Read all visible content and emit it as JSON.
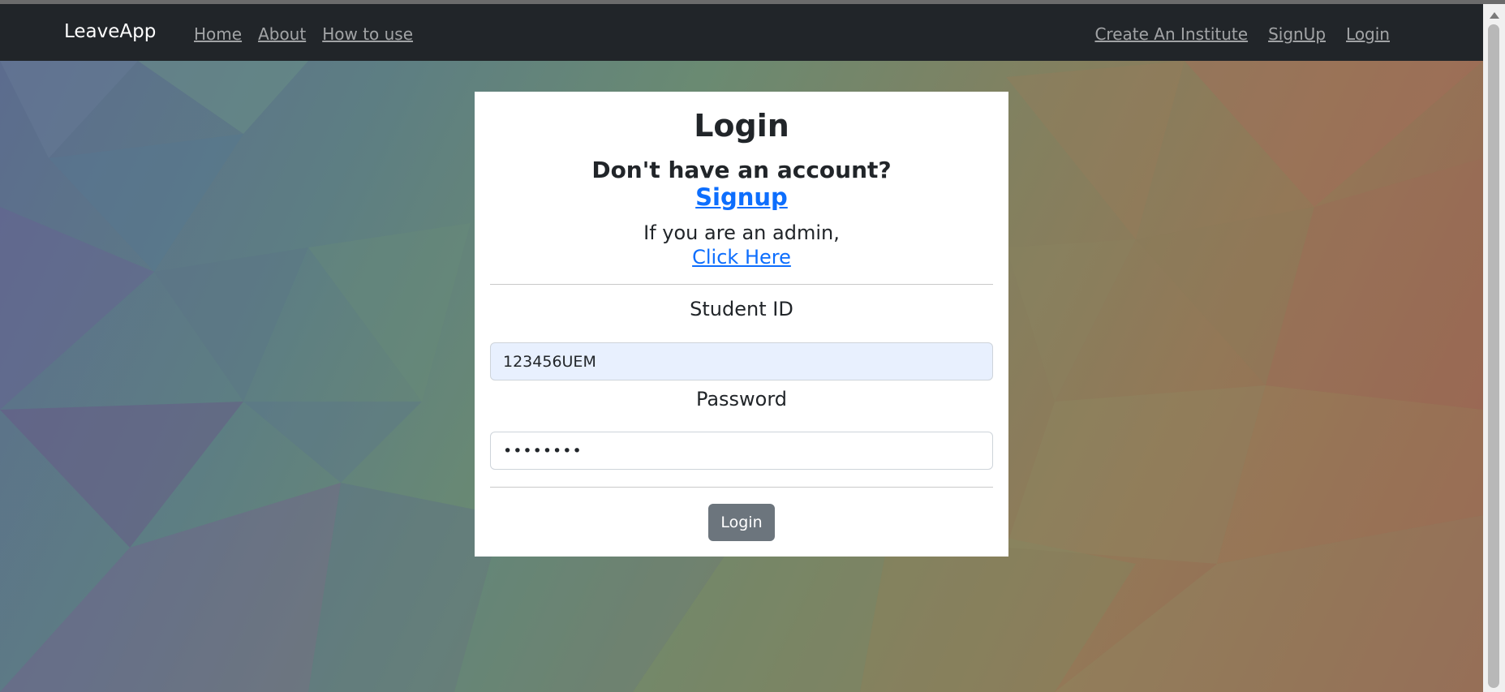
{
  "navbar": {
    "brand": "LeaveApp",
    "left_links": [
      "Home",
      "About",
      "How to use"
    ],
    "right_links": [
      "Create An Institute",
      "SignUp",
      "Login"
    ]
  },
  "login_card": {
    "title": "Login",
    "no_account_text": "Don't have an account?",
    "signup_link": "Signup",
    "admin_text": "If you are an admin,",
    "admin_link": "Click Here",
    "student_id_label": "Student ID",
    "student_id_value": "123456UEM",
    "password_label": "Password",
    "password_value": "••••••••",
    "submit_label": "Login"
  },
  "colors": {
    "navbar_bg": "#212529",
    "link_blue": "#0d6efd",
    "button_gray": "#6c757d",
    "autofill_bg": "#e8f0fe"
  }
}
